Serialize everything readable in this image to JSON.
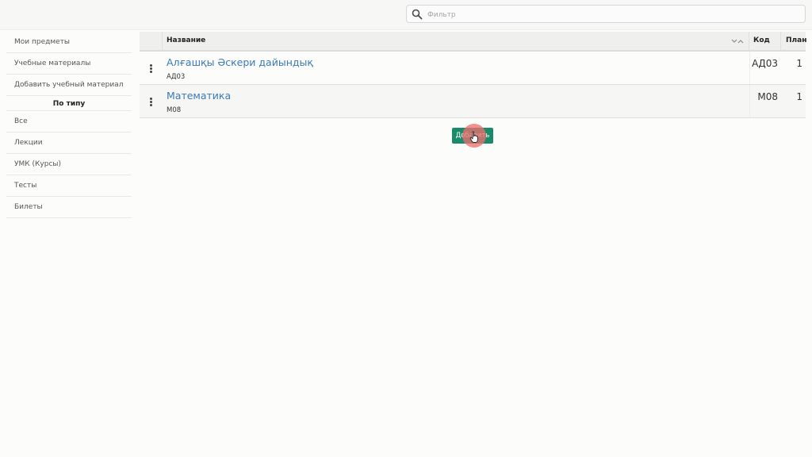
{
  "search": {
    "placeholder": "Фильтр",
    "value": ""
  },
  "sidebar": {
    "items": [
      {
        "label": "Мои предметы"
      },
      {
        "label": "Учебные материалы"
      },
      {
        "label": "Добавить учебный материал"
      }
    ],
    "section_header": "По типу",
    "type_items": [
      {
        "label": "Все"
      },
      {
        "label": "Лекции"
      },
      {
        "label": "УМК (Курсы)"
      },
      {
        "label": "Тесты"
      },
      {
        "label": "Билеты"
      }
    ]
  },
  "table": {
    "columns": {
      "name": "Название",
      "code": "Код",
      "plan": "План"
    },
    "rows": [
      {
        "name": "Алғашқы Әскери дайындық",
        "subcode": "АД03",
        "code": "АД03",
        "plan": "1"
      },
      {
        "name": "Математика",
        "subcode": "М08",
        "code": "М08",
        "plan": "1"
      }
    ]
  },
  "actions": {
    "add_label": "Добавить"
  },
  "icons": {
    "search": "search-icon",
    "sort": "sort-icon",
    "row_menu": "kebab-menu-icon",
    "cursor": "hand-cursor-icon"
  },
  "colors": {
    "link": "#3a7ab6",
    "button": "#1b8a6b",
    "click_highlight": "#f06e6e"
  }
}
